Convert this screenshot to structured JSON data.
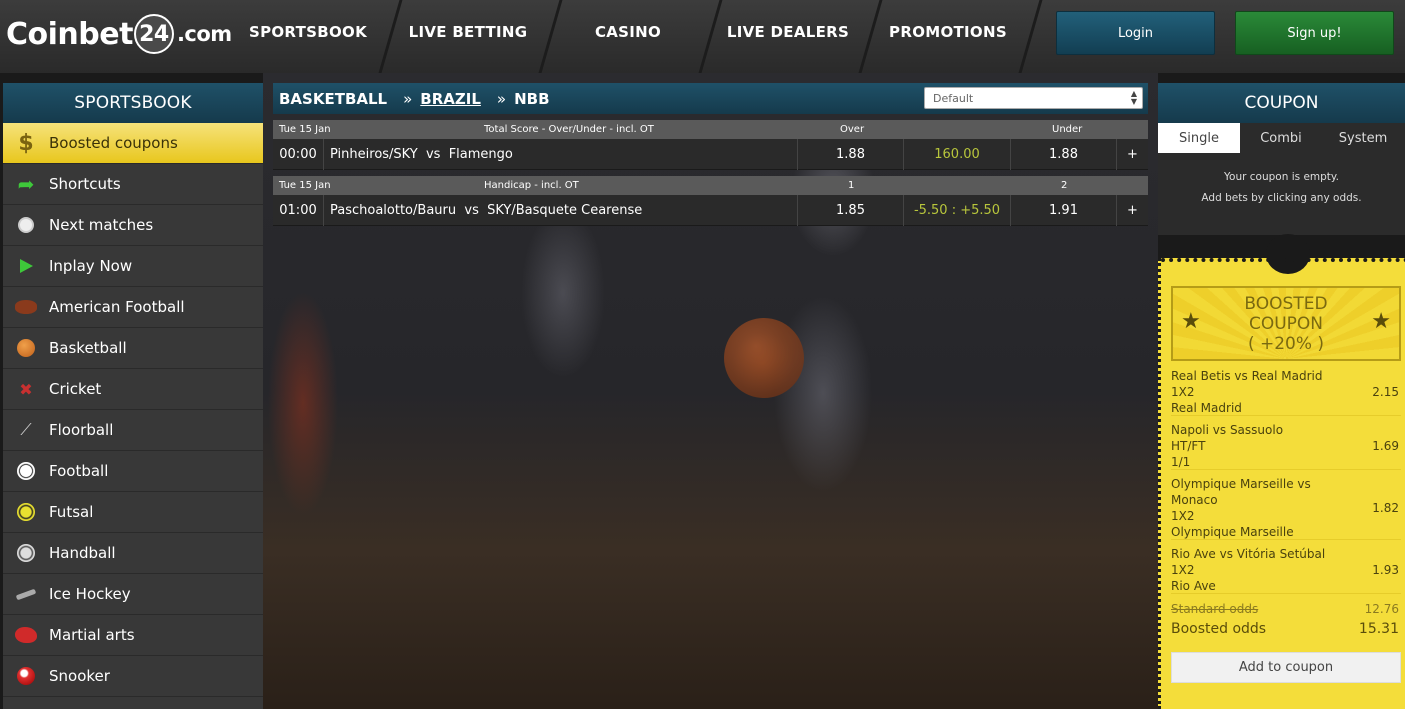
{
  "logo": {
    "prefix": "Coinbet",
    "badge": "24",
    "suffix": ".com"
  },
  "nav": [
    "SPORTSBOOK",
    "LIVE BETTING",
    "CASINO",
    "LIVE DEALERS",
    "PROMOTIONS"
  ],
  "auth": {
    "login": "Login",
    "signup": "Sign up!"
  },
  "sidebar": {
    "title": "SPORTSBOOK",
    "items": [
      {
        "label": "Boosted coupons",
        "icon": "dollar-icon"
      },
      {
        "label": "Shortcuts",
        "icon": "arrow-icon"
      },
      {
        "label": "Next matches",
        "icon": "clock-icon"
      },
      {
        "label": "Inplay Now",
        "icon": "play-icon"
      },
      {
        "label": "American Football",
        "icon": "american-football-icon"
      },
      {
        "label": "Basketball",
        "icon": "basketball-icon"
      },
      {
        "label": "Cricket",
        "icon": "cricket-icon"
      },
      {
        "label": "Floorball",
        "icon": "floorball-icon"
      },
      {
        "label": "Football",
        "icon": "football-icon"
      },
      {
        "label": "Futsal",
        "icon": "futsal-icon"
      },
      {
        "label": "Handball",
        "icon": "handball-icon"
      },
      {
        "label": "Ice Hockey",
        "icon": "ice-hockey-icon"
      },
      {
        "label": "Martial arts",
        "icon": "martial-arts-icon"
      },
      {
        "label": "Snooker",
        "icon": "snooker-icon"
      }
    ]
  },
  "breadcrumb": {
    "sport": "BASKETBALL",
    "country": "BRAZIL",
    "league": "NBB",
    "sort_value": "Default"
  },
  "markets": [
    {
      "date": "Tue 15 Jan",
      "market": "Total Score - Over/Under - incl. OT",
      "col1": "Over",
      "col2": "Under",
      "time": "00:00",
      "home": "Pinheiros/SKY",
      "vs": "vs",
      "away": "Flamengo",
      "odd1": "1.88",
      "line": "160.00",
      "odd2": "1.88",
      "more": "+"
    },
    {
      "date": "Tue 15 Jan",
      "market": "Handicap - incl. OT",
      "col1": "1",
      "col2": "2",
      "time": "01:00",
      "home": "Paschoalotto/Bauru",
      "vs": "vs",
      "away": "SKY/Basquete Cearense",
      "odd1": "1.85",
      "line": "-5.50 : +5.50",
      "odd2": "1.91",
      "more": "+"
    }
  ],
  "coupon": {
    "title": "COUPON",
    "tabs": [
      "Single",
      "Combi",
      "System"
    ],
    "empty_line1": "Your coupon is empty.",
    "empty_line2": "Add bets by clicking any odds."
  },
  "boosted": {
    "title_line1": "BOOSTED",
    "title_line2": "COUPON",
    "title_line3": "( +20% )",
    "bets": [
      {
        "match": "Real Betis vs Real Madrid",
        "market": "1X2",
        "pick": "Real Madrid",
        "odd": "2.15"
      },
      {
        "match": "Napoli vs Sassuolo",
        "market": "HT/FT",
        "pick": "1/1",
        "odd": "1.69"
      },
      {
        "match": "Olympique Marseille vs Monaco",
        "market": "1X2",
        "pick": "Olympique Marseille",
        "odd": "1.82"
      },
      {
        "match": "Rio Ave vs Vitória Setúbal",
        "market": "1X2",
        "pick": "Rio Ave",
        "odd": "1.93"
      }
    ],
    "standard_label": "Standard odds",
    "standard_value": "12.76",
    "boosted_label": "Boosted odds",
    "boosted_value": "15.31",
    "add_button": "Add to coupon"
  }
}
